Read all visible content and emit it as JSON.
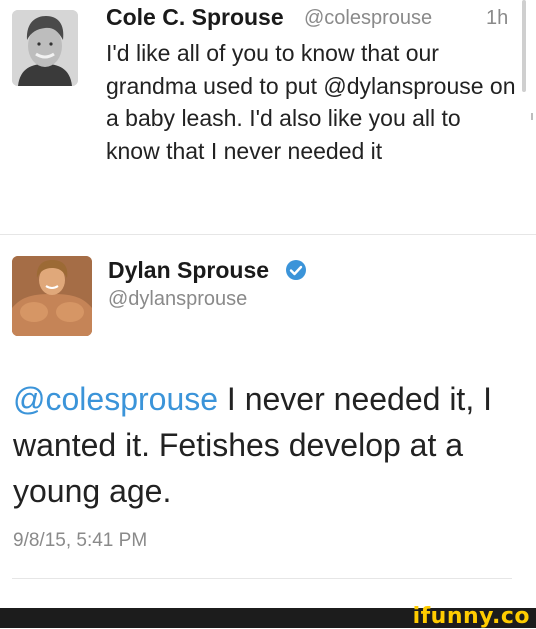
{
  "tweet1": {
    "name": "Cole C. Sprouse",
    "handle": "@colesprouse",
    "time": "1h",
    "text": "I'd like all of you to know that our grandma used to put @dylansprouse on a baby leash. I'd also like you all to know that I never needed it"
  },
  "tweet2": {
    "name": "Dylan Sprouse",
    "handle": "@dylansprouse",
    "verified_icon": "verified-badge-icon",
    "mention": "@colesprouse",
    "text": " I never needed it, I wanted it. Fetishes develop at a young age.",
    "date": "9/8/15, 5:41 PM"
  },
  "watermark": {
    "text": "ifunny.co"
  },
  "colors": {
    "link": "#3b94d9",
    "muted": "#8a8a8a",
    "watermark": "#ffcc00",
    "footer": "#1c1c1c"
  }
}
